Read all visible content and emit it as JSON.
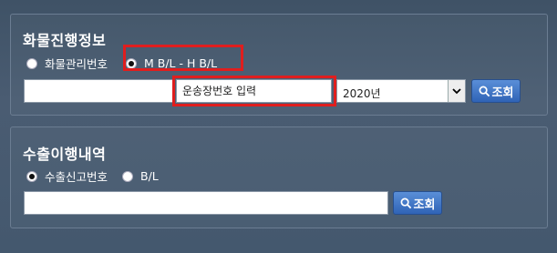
{
  "panel1": {
    "title": "화물진행정보",
    "radio_options": [
      {
        "label": "화물관리번호",
        "checked": false
      },
      {
        "label": "M B/L - H B/L",
        "checked": true
      }
    ],
    "mbl_input_value": "",
    "hbl_input_placeholder": "운송장번호 입력",
    "year_select_value": "2020년",
    "search_button_label": "조회"
  },
  "panel2": {
    "title": "수출이행내역",
    "radio_options": [
      {
        "label": "수출신고번호",
        "checked": true
      },
      {
        "label": "B/L",
        "checked": false
      }
    ],
    "input_value": "",
    "search_button_label": "조회"
  },
  "icons": {
    "search": "magnifier-icon",
    "dropdown": "chevron-down-icon"
  },
  "colors": {
    "highlight": "#e01e1e",
    "button": "#3a70c4",
    "background": "#44586e"
  }
}
